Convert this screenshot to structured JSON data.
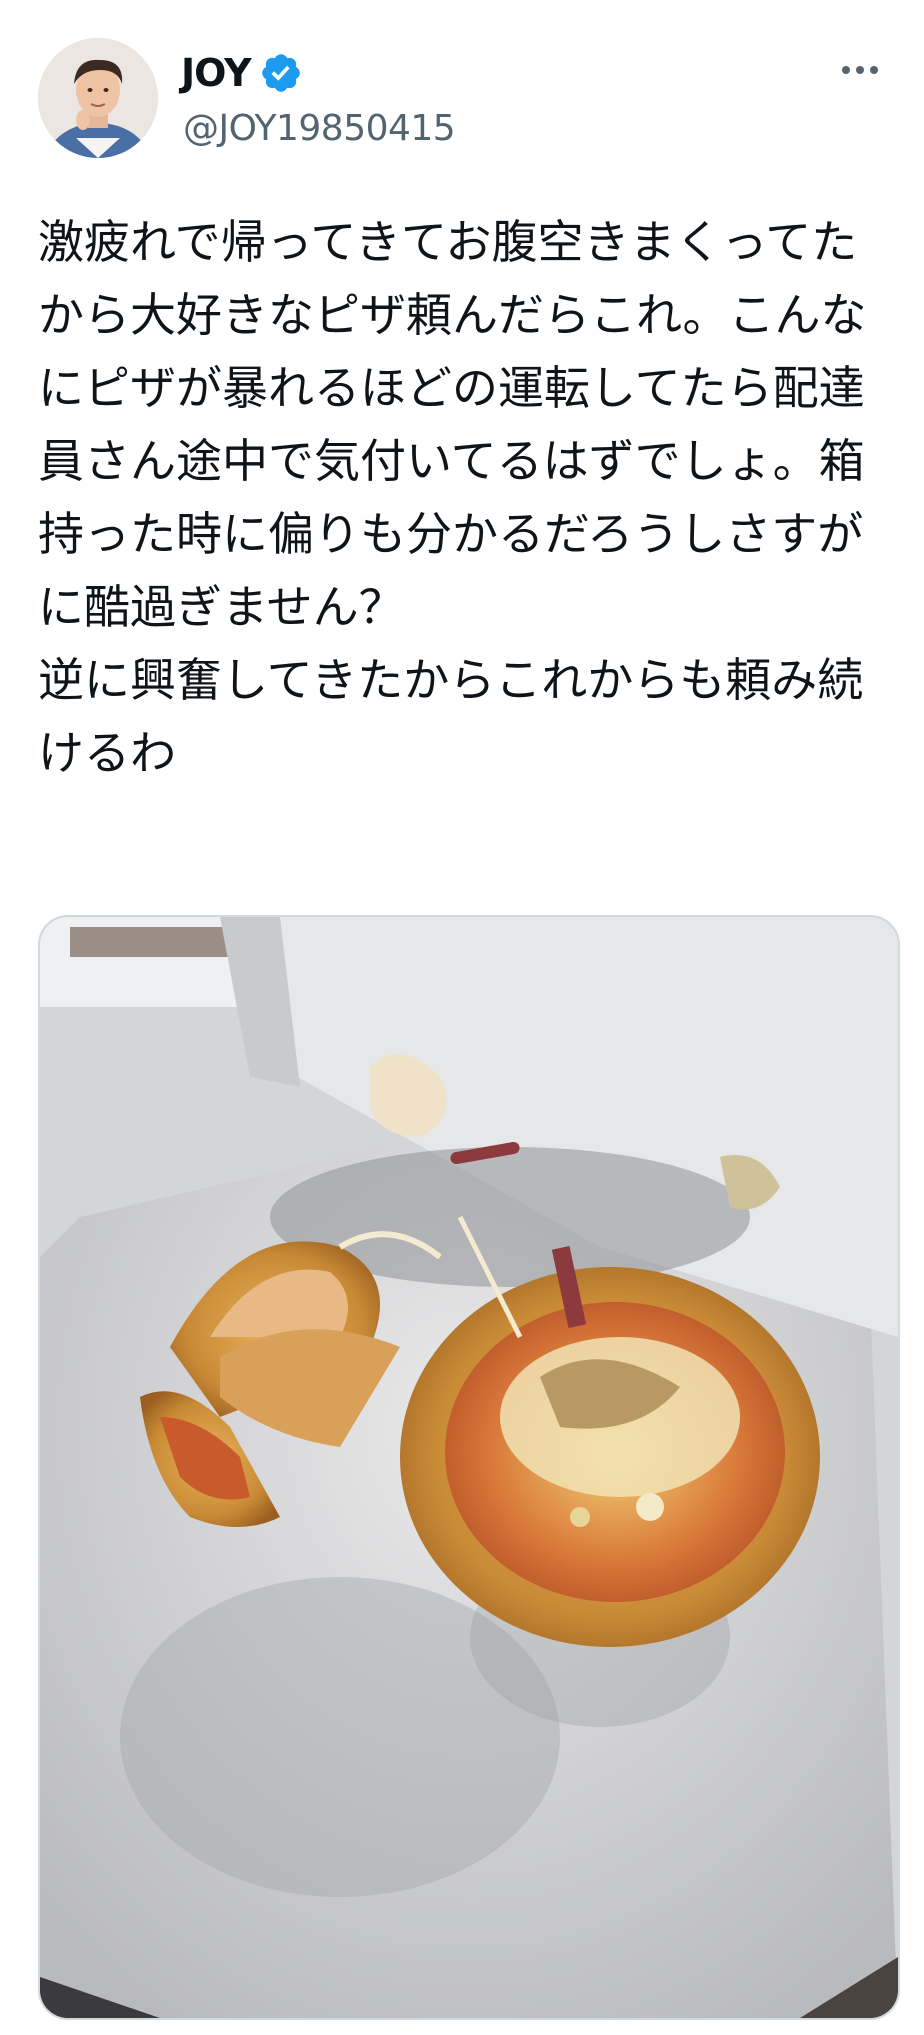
{
  "author": {
    "display_name": "JOY",
    "handle": "@JOY19850415",
    "verified": true,
    "verified_color": "#1d9bf0"
  },
  "icons": {
    "avatar": "profile-photo",
    "verified": "verified-badge-icon",
    "more": "more-options-icon"
  },
  "tweet": {
    "text": "激疲れで帰ってきてお腹空きまくってたから大好きなピザ頼んだらこれ。こんなにピザが暴れるほどの運転してたら配達員さん途中で気付いてるはずでしょ。箱持った時に偏りも分かるだろうしさすがに酷過ぎません？\n逆に興奮してきたからこれからも頼み続けるわ"
  },
  "media": {
    "type": "photo",
    "subject": "pizza-in-box"
  }
}
